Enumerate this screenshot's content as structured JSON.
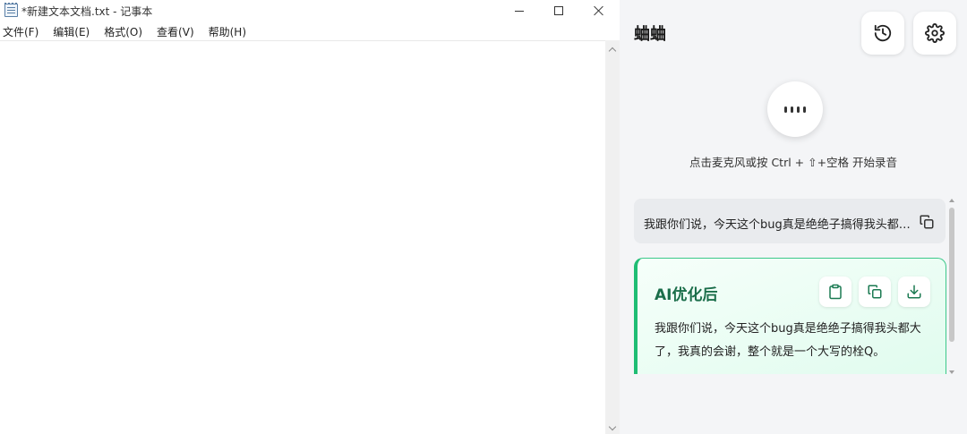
{
  "notepad": {
    "title": "*新建文本文档.txt - 记事本",
    "menu": [
      "文件(F)",
      "编辑(E)",
      "格式(O)",
      "查看(V)",
      "帮助(H)"
    ],
    "content": ""
  },
  "panel": {
    "title": "蛐蛐",
    "hint": "点击麦克风或按 Ctrl + ⇧+空格 开始录音",
    "raw_text": "我跟你们说，今天这个bug真是绝绝子搞得我头都大了，我真的会谢",
    "ai_title": "AI优化后",
    "ai_text": "我跟你们说，今天这个bug真是绝绝子搞得我头都大了，我真的会谢，整个就是一个大写的栓Q。"
  },
  "colors": {
    "accent_green": "#1fbd74",
    "ai_title_green": "#1b6e4a",
    "panel_bg": "#f4f5f7"
  },
  "icons": {
    "history": "history-icon",
    "settings": "gear-icon",
    "mic": "microphone-icon",
    "copy": "copy-icon",
    "clipboard": "clipboard-icon",
    "download": "download-icon"
  }
}
